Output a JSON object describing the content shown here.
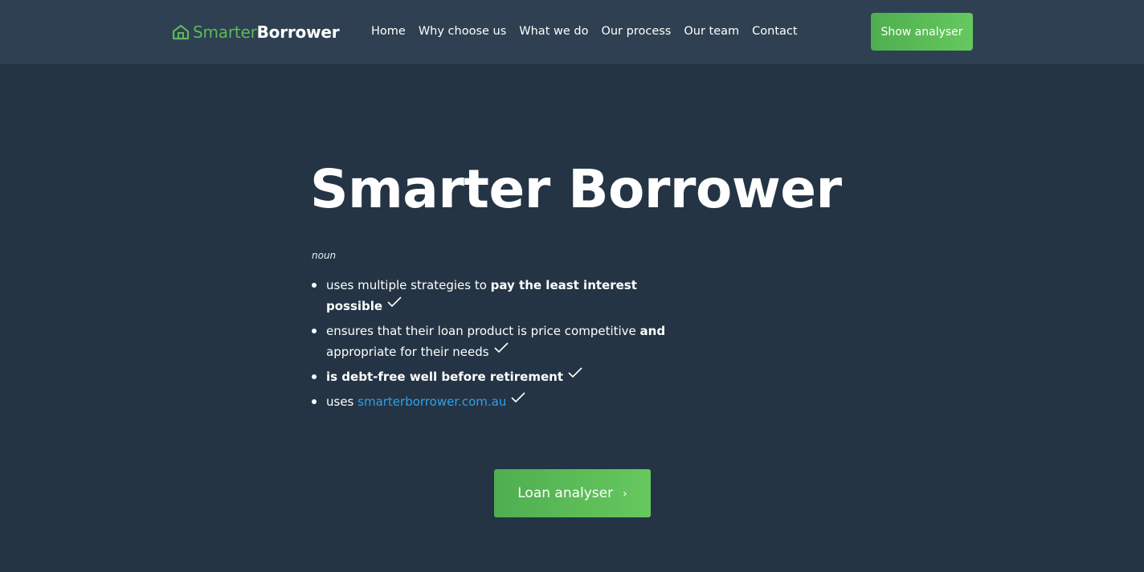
{
  "logo": {
    "word1": "Smarter",
    "word2": "Borrower",
    "icon": "house-icon",
    "brand_color": "#5cb85c"
  },
  "nav": {
    "items": [
      "Home",
      "Why choose us",
      "What we do",
      "Our process",
      "Our team",
      "Contact"
    ]
  },
  "header_button": "Show analyser",
  "hero": {
    "title": "Smarter Borrower",
    "word_class": "noun",
    "items": [
      {
        "pre": "uses multiple strategies to ",
        "bold": "pay the least interest possible",
        "post": ""
      },
      {
        "pre": "ensures that their loan product is price competitive ",
        "bold": "and",
        "post": " appropriate for their needs"
      },
      {
        "pre": "",
        "bold": "is debt-free well before retirement",
        "post": ""
      },
      {
        "pre": "uses ",
        "link": "smarterborrower.com.au"
      }
    ],
    "check_icon": "check-icon"
  },
  "cta_button": {
    "label": "Loan analyser",
    "icon": "chevron-right-icon"
  },
  "colors": {
    "background": "#243444",
    "navbar": "#2e4051",
    "accent": "#5cb85c",
    "link": "#2fa0e9"
  }
}
